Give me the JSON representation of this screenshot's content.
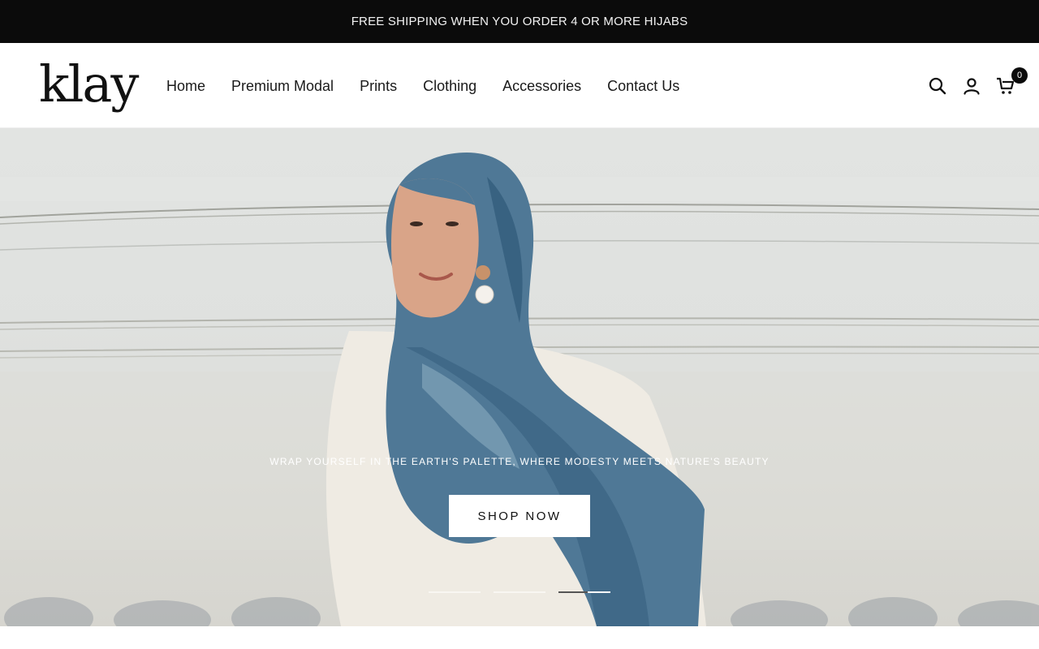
{
  "announcement": {
    "text": "FREE SHIPPING WHEN YOU ORDER 4 OR MORE HIJABS"
  },
  "header": {
    "logo": "klay",
    "nav": [
      {
        "label": "Home"
      },
      {
        "label": "Premium Modal"
      },
      {
        "label": "Prints"
      },
      {
        "label": "Clothing"
      },
      {
        "label": "Accessories"
      },
      {
        "label": "Contact Us"
      }
    ],
    "icons": [
      "search-icon",
      "account-icon",
      "cart-icon"
    ],
    "cart_count": "0"
  },
  "hero": {
    "tagline": "WRAP YOURSELF IN THE EARTH'S PALETTE, WHERE MODESTY MEETS NATURE'S BEAUTY",
    "cta_label": "SHOP NOW",
    "slides_total": 3,
    "active_slide": 3,
    "active_slide_progress": 0.55
  },
  "colors": {
    "announcement_bg": "#0b0b0b",
    "scarf_blue": "#4f7896",
    "wall": "#e2e4e2"
  }
}
